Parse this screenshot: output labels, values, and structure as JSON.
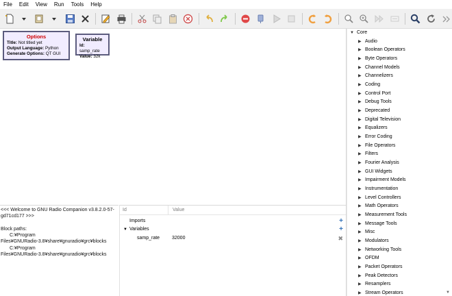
{
  "menu": [
    "File",
    "Edit",
    "View",
    "Run",
    "Tools",
    "Help"
  ],
  "options_block": {
    "title": "Options",
    "rows": [
      {
        "key": "Title:",
        "value": "Not titled yet"
      },
      {
        "key": "Output Language:",
        "value": "Python"
      },
      {
        "key": "Generate Options:",
        "value": "QT GUI"
      }
    ]
  },
  "variable_block": {
    "title": "Variable",
    "rows": [
      {
        "key": "Id:",
        "value": "samp_rate"
      },
      {
        "key": "Value:",
        "value": "32k"
      }
    ]
  },
  "console": {
    "lines": [
      "<<< Welcome to GNU Radio Companion v3.8.2.0-57-",
      "gd71cd177 >>>",
      "",
      "Block paths:",
      "C:¥Program",
      "Files¥GNURadio-3.8¥share¥gnuradio¥grc¥blocks",
      "C:¥Program",
      "Files¥GNURadio-3.8¥share¥gnuradio¥grc¥blocks"
    ]
  },
  "variables_panel": {
    "col_id": "Id",
    "col_value": "Value",
    "imports_label": "Imports",
    "variables_label": "Variables",
    "var_name": "samp_rate",
    "var_value": "32000"
  },
  "tree": {
    "root": "Core",
    "categories": [
      "Audio",
      "Boolean Operators",
      "Byte Operators",
      "Channel Models",
      "Channelizers",
      "Coding",
      "Control Port",
      "Debug Tools",
      "Deprecated",
      "Digital Television",
      "Equalizers",
      "Error Coding",
      "File Operators",
      "Filters",
      "Fourier Analysis",
      "GUI Widgets",
      "Impairment Models",
      "Instrumentation",
      "Level Controllers",
      "Math Operators",
      "Measurement Tools",
      "Message Tools",
      "Misc",
      "Modulators",
      "Networking Tools",
      "OFDM",
      "Packet Operators",
      "Peak Detectors",
      "Resamplers",
      "Stream Operators"
    ]
  },
  "colors": {
    "block_border": "#5b5b7d",
    "block_fill": "#f1ecff",
    "options_title": "#d00000",
    "add_icon": "#2f6fb7"
  }
}
